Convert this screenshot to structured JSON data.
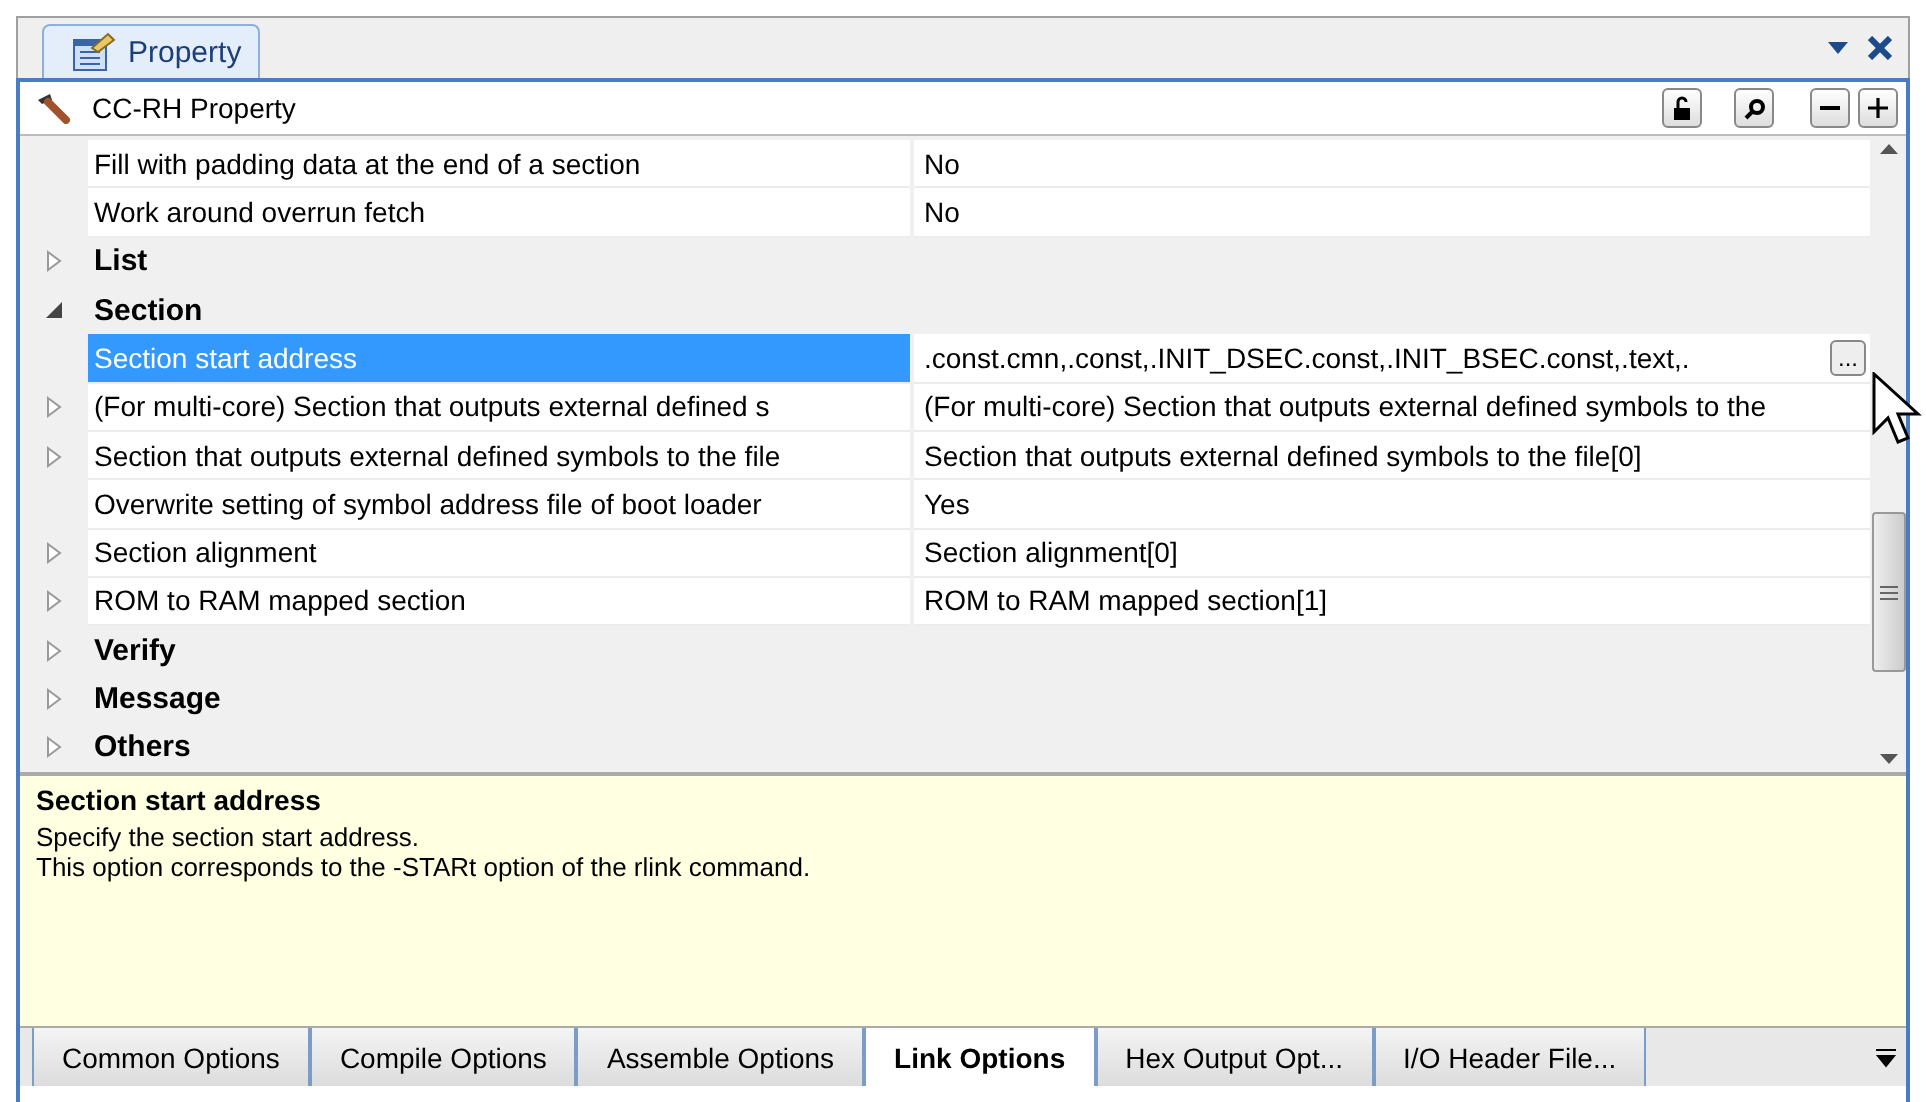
{
  "panel_tab": {
    "label": "Property",
    "selected": true
  },
  "header": {
    "title": "CC-RH Property"
  },
  "rows": [
    {
      "kind": "property",
      "name": "Fill with padding data at the end of a section",
      "value": "No",
      "collapsible": false,
      "selected": false
    },
    {
      "kind": "property",
      "name": "Work around overrun fetch",
      "value": "No",
      "collapsible": false,
      "selected": false
    },
    {
      "kind": "category",
      "name": "List",
      "expanded": false,
      "selected": false
    },
    {
      "kind": "category",
      "name": "Section",
      "expanded": true,
      "selected": false
    },
    {
      "kind": "property",
      "name": "Section start address",
      "value": ".const.cmn,.const,.INIT_DSEC.const,.INIT_BSEC.const,.text,.",
      "collapsible": false,
      "selected": true,
      "button": "..."
    },
    {
      "kind": "property",
      "name": "(For multi-core) Section that outputs external defined s",
      "value": "(For multi-core) Section that outputs external defined symbols to the",
      "collapsible": true,
      "selected": false
    },
    {
      "kind": "property",
      "name": "Section that outputs external defined symbols to the file",
      "value": "Section that outputs external defined symbols to the file[0]",
      "collapsible": true,
      "selected": false
    },
    {
      "kind": "property",
      "name": "Overwrite setting of symbol address file of boot loader",
      "value": "Yes",
      "collapsible": false,
      "selected": false
    },
    {
      "kind": "property",
      "name": "Section alignment",
      "value": "Section alignment[0]",
      "collapsible": true,
      "selected": false
    },
    {
      "kind": "property",
      "name": "ROM to RAM mapped section",
      "value": "ROM to RAM mapped section[1]",
      "collapsible": true,
      "selected": false
    },
    {
      "kind": "category",
      "name": "Verify",
      "expanded": false,
      "selected": false
    },
    {
      "kind": "category",
      "name": "Message",
      "expanded": false,
      "selected": false
    },
    {
      "kind": "category",
      "name": "Others",
      "expanded": false,
      "selected": false
    }
  ],
  "description": {
    "title": "Section start address",
    "lines": [
      "Specify the section start address.",
      "This option corresponds to the -STARt option of the rlink command."
    ]
  },
  "bottom_tabs": [
    {
      "label": "Common Options",
      "selected": false
    },
    {
      "label": "Compile Options",
      "selected": false
    },
    {
      "label": "Assemble Options",
      "selected": false
    },
    {
      "label": "Link Options",
      "selected": true
    },
    {
      "label": "Hex Output Opt...",
      "selected": false
    },
    {
      "label": "I/O Header File...",
      "selected": false
    }
  ]
}
